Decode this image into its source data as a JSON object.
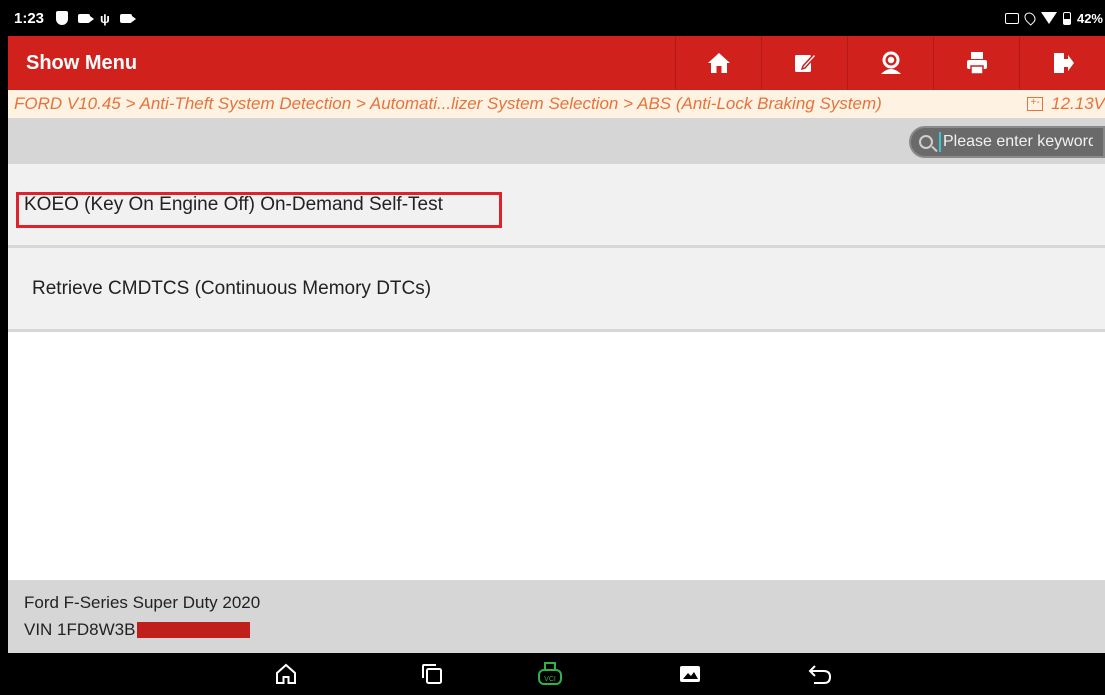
{
  "status_bar": {
    "time": "1:23",
    "battery": "42%",
    "icons": [
      "shield-icon",
      "camera-icon",
      "usb-icon",
      "camera-icon",
      "cast-icon",
      "location-icon",
      "wifi-icon",
      "battery-icon"
    ]
  },
  "header": {
    "title": "Show Menu",
    "toolbar": [
      "home-icon",
      "edit-report-icon",
      "user-support-icon",
      "print-icon",
      "exit-icon"
    ]
  },
  "breadcrumb": {
    "path": "FORD V10.45 > Anti-Theft System Detection > Automati...lizer System Selection > ABS (Anti-Lock Braking System)",
    "voltage": "12.13V"
  },
  "search": {
    "placeholder": "Please enter keyword",
    "value": ""
  },
  "menu": {
    "items": [
      {
        "label": "KOEO (Key On Engine Off) On-Demand Self-Test",
        "highlighted": true
      },
      {
        "label": "Retrieve CMDTCS (Continuous Memory DTCs)",
        "highlighted": false
      }
    ]
  },
  "footer": {
    "vehicle": "Ford F-Series Super Duty 2020",
    "vin_prefix": "VIN 1FD8W3B"
  },
  "nav_bar": [
    "home-icon",
    "recent-apps-icon",
    "vci-icon",
    "screenshot-icon",
    "back-icon"
  ],
  "colors": {
    "header_red": "#d0211d",
    "breadcrumb_text": "#e8723c",
    "highlight_box": "#e0202b",
    "vci_green": "#2fb24a"
  }
}
